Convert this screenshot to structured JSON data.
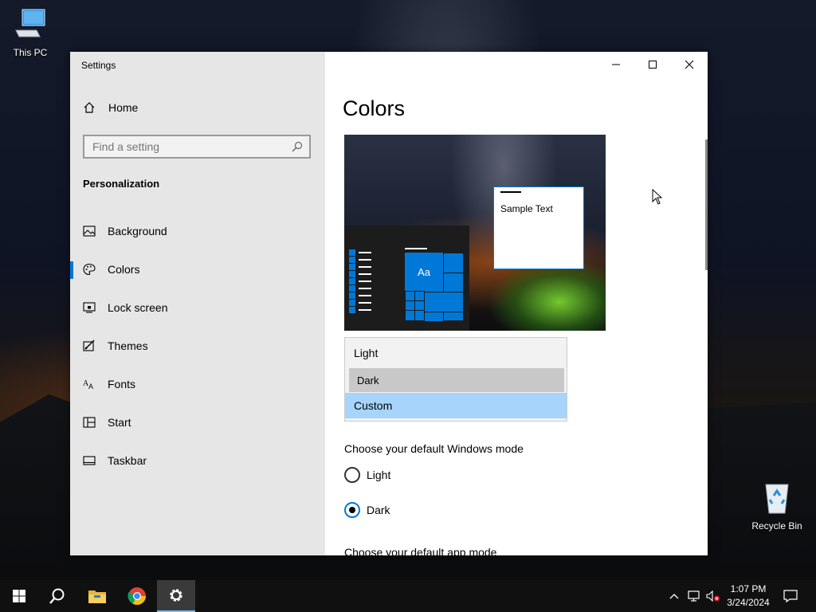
{
  "desktop": {
    "icons": [
      {
        "label": "This PC",
        "icon": "computer-icon"
      },
      {
        "label": "Recycle Bin",
        "icon": "recycle-bin-icon"
      }
    ]
  },
  "window": {
    "title": "Settings",
    "controls": [
      "minimize-icon",
      "maximize-icon",
      "close-icon"
    ]
  },
  "sidebar": {
    "home_label": "Home",
    "search": {
      "placeholder": "Find a setting",
      "value": ""
    },
    "section": "Personalization",
    "items": [
      {
        "label": "Background",
        "icon": "picture-icon"
      },
      {
        "label": "Colors",
        "icon": "palette-icon",
        "selected": true
      },
      {
        "label": "Lock screen",
        "icon": "lock-screen-icon"
      },
      {
        "label": "Themes",
        "icon": "themes-icon"
      },
      {
        "label": "Fonts",
        "icon": "fonts-icon"
      },
      {
        "label": "Start",
        "icon": "start-icon"
      },
      {
        "label": "Taskbar",
        "icon": "taskbar-icon"
      }
    ]
  },
  "main": {
    "title": "Colors",
    "preview": {
      "sample_text": "Sample Text",
      "tile_label": "Aa"
    },
    "choose_color_dropdown": {
      "options": [
        "Light",
        "Dark",
        "Custom"
      ],
      "selected": "Custom",
      "hovered": "Dark"
    },
    "windows_mode": {
      "label": "Choose your default Windows mode",
      "options": [
        "Light",
        "Dark"
      ],
      "selected": "Dark"
    },
    "app_mode_label": "Choose your default app mode"
  },
  "taskbar": {
    "buttons": [
      "start-icon",
      "search-icon",
      "file-explorer-icon",
      "chrome-icon",
      "settings-icon"
    ],
    "active": "settings-icon",
    "tray": [
      "chevron-up-icon",
      "network-icon",
      "volume-muted-icon",
      "notification-icon"
    ],
    "time": "1:07 PM",
    "date": "3/24/2024"
  },
  "colors": {
    "accent": "#0078d7",
    "sidebar_bg": "#e6e6e6",
    "selected_option": "#a6d4fa",
    "hovered_option": "#c8c8c8",
    "taskbar": "#101010"
  }
}
